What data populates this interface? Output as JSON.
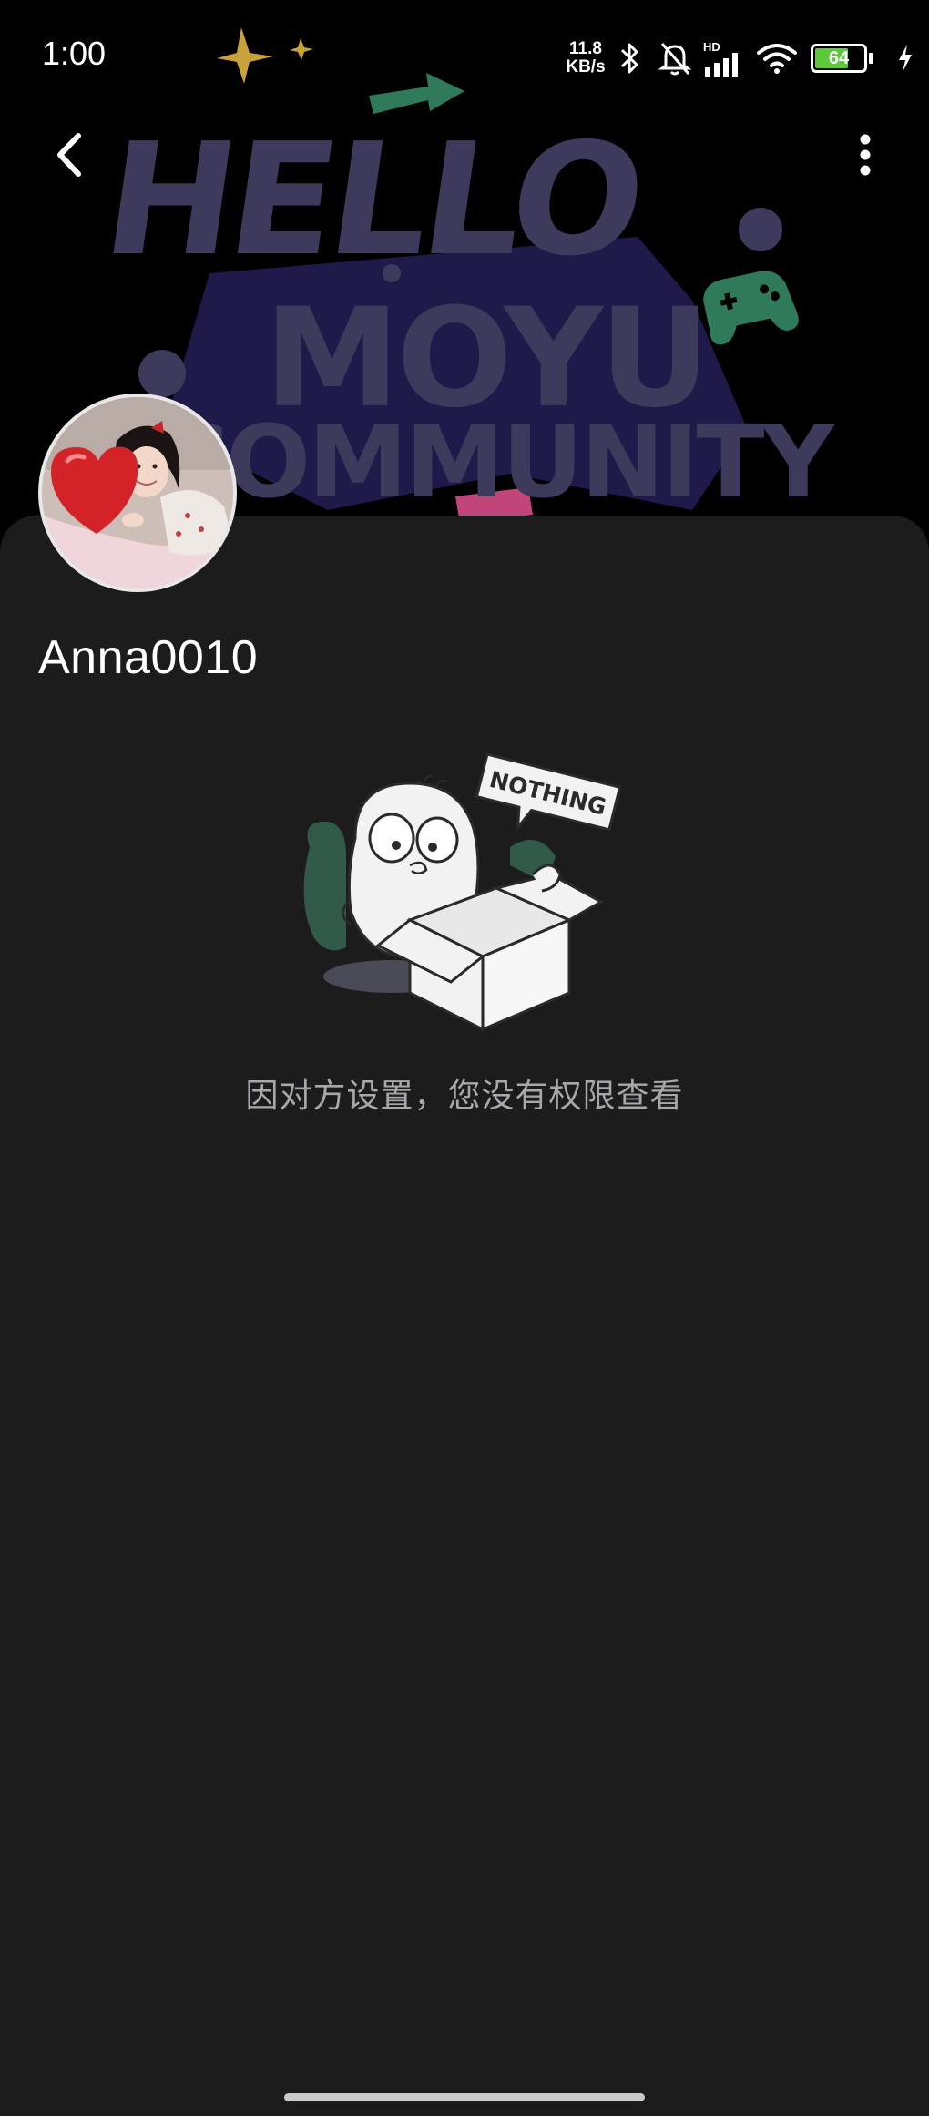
{
  "status_bar": {
    "time": "1:00",
    "net_speed_value": "11.8",
    "net_speed_unit": "KB/s",
    "hd_label": "HD",
    "battery_level": "64",
    "icons": [
      "bluetooth-icon",
      "mute-icon",
      "signal-icon",
      "wifi-icon",
      "battery-icon",
      "charging-icon"
    ]
  },
  "banner": {
    "line1": "HELLO",
    "line2": "MOYU",
    "line3": "COMMUNITY",
    "accent_purple": "#3d3a5c",
    "accent_green": "#2f7a5a"
  },
  "nav": {
    "back_icon": "chevron-left-icon",
    "more_icon": "more-vertical-icon"
  },
  "profile": {
    "username": "Anna0010"
  },
  "empty_state": {
    "illustration_label": "NOTHING",
    "message": "因对方设置，您没有权限查看"
  },
  "colors": {
    "background": "#000000",
    "sheet": "#1c1c1d",
    "muted_text": "#a8a8ab"
  }
}
